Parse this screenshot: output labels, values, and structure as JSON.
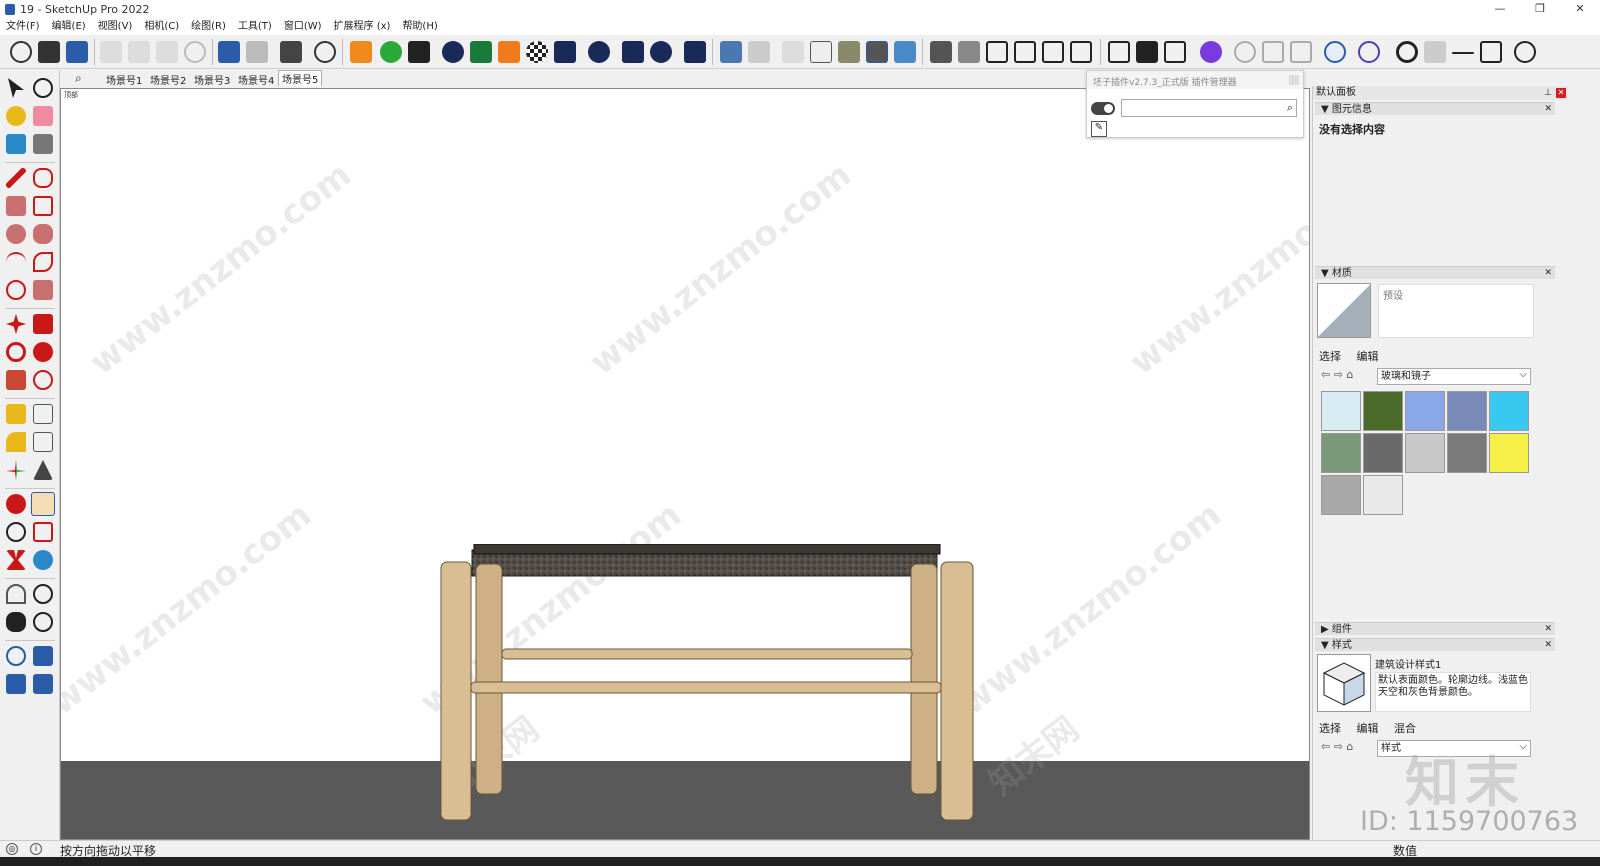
{
  "window": {
    "title": "19 - SketchUp Pro 2022",
    "controls": [
      "—",
      "❐",
      "✕"
    ]
  },
  "menu": [
    "文件(F)",
    "编辑(E)",
    "视图(V)",
    "相机(C)",
    "绘图(R)",
    "工具(T)",
    "窗口(W)",
    "扩展程序 (x)",
    "帮助(H)"
  ],
  "scenes": {
    "tabs": [
      "场景号1",
      "场景号2",
      "场景号3",
      "场景号4",
      "场景号5"
    ],
    "active_index": 4
  },
  "viewport": {
    "corner_label": "顶部"
  },
  "plugin": {
    "title": "坯子插件v2.7.3_正式版 插件管理器",
    "search_value": ""
  },
  "tray": {
    "title": "默认面板",
    "entity_info": {
      "header": "图元信息",
      "empty_text": "没有选择内容"
    },
    "materials": {
      "header": "材质",
      "default_label": "预设",
      "tabs": [
        "选择",
        "编辑"
      ],
      "library": "玻璃和镜子",
      "swatch_colors": [
        "#d8ecf4",
        "#4a6a2a",
        "#8aa8e8",
        "#7a8ab8",
        "#38c8f0",
        "#7a9a7a",
        "#6a6a6a",
        "#c8c8c8",
        "#7a7a7a",
        "#f4f048",
        "#a8a8a8",
        "#e8e8e8"
      ]
    },
    "components": {
      "header": "组件"
    },
    "styles": {
      "header": "样式",
      "name": "建筑设计样式1",
      "description": "默认表面颜色。轮廓边线。浅蓝色天空和灰色背景颜色。",
      "tabs": [
        "选择",
        "编辑",
        "混合"
      ],
      "library": "样式"
    }
  },
  "status": {
    "hint": "按方向拖动以平移",
    "vcb_label": "数值"
  },
  "watermarks": {
    "site": "www.znzmo.com",
    "brand": "知末网",
    "logo": "知末",
    "id": "ID: 1159700763"
  },
  "colors": {
    "ground": "#595959",
    "accent": "#2a5ca8"
  }
}
